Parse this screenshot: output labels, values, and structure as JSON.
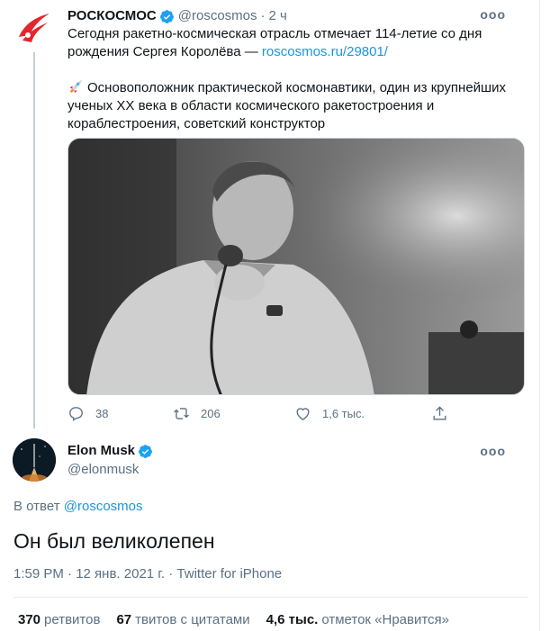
{
  "tweet": {
    "author_name": "РОСКОСМОС",
    "author_handle": "@roscosmos",
    "dot": "·",
    "time": "2 ч",
    "text_line1": "Сегодня ракетно-космическая отрасль отмечает 114-летие со дня",
    "text_line2_prefix": "рождения Сергея Королёва — ",
    "link": "roscosmos.ru/29801/",
    "para2_line1": "Основоположник практической космонавтики, один из крупнейших",
    "para2_line2": "ученых XX века в области космического ракетостроения и",
    "para2_line3": "кораблестроения, советский конструктор",
    "more": "ooo",
    "counts": {
      "replies": "38",
      "retweets": "206",
      "likes": "1,6 тыс."
    }
  },
  "reply": {
    "author_name": "Elon Musk",
    "author_handle": "@elonmusk",
    "more": "ooo",
    "reply_prefix": "В ответ ",
    "reply_handle": "@roscosmos",
    "text": "Он был великолепен",
    "meta": "1:59 PM · 12 янв. 2021 г. · Twitter for iPhone",
    "stats": {
      "retweets_value": "370",
      "retweets_label": "ретвитов",
      "quotes_value": "67",
      "quotes_label": "твитов с цитатами",
      "likes_value": "4,6 тыс.",
      "likes_label": "отметок «Нравится»"
    }
  },
  "colors": {
    "link": "#1b95e0",
    "muted": "#5b7083",
    "verified": "#1da1f2",
    "roscosmos_red": "#e3262d"
  },
  "icons": [
    "roscosmos-logo-icon",
    "verified-icon",
    "rocket-emoji-icon",
    "reply-icon",
    "retweet-icon",
    "like-icon",
    "share-icon",
    "more-icon",
    "rocket-launch-avatar"
  ]
}
